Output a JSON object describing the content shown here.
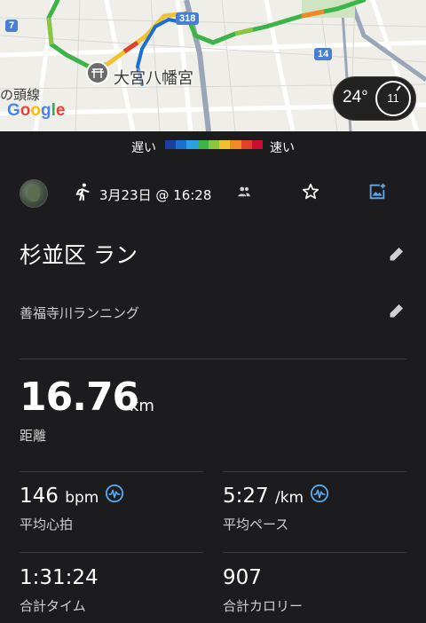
{
  "map": {
    "place_label": "大宮八幡宮",
    "left_label": "の頭線",
    "route_318": "318",
    "route_14": "14",
    "route_7": "7",
    "google_letters": [
      "G",
      "o",
      "o",
      "g",
      "l",
      "e"
    ],
    "google_colors": [
      "#4285F4",
      "#EA4335",
      "#FBBC05",
      "#4285F4",
      "#34A853",
      "#EA4335"
    ],
    "temperature": "24°",
    "wind": "11"
  },
  "legend": {
    "slow": "遅い",
    "fast": "速い",
    "colors": [
      "#1e3fa0",
      "#1a6fd0",
      "#2aa0e0",
      "#3cb44a",
      "#8cc63f",
      "#f2c12e",
      "#f08a24",
      "#e2402a",
      "#c8102e"
    ]
  },
  "header": {
    "date": "3月23日 @ 16:28"
  },
  "activity": {
    "title": "杉並区 ラン",
    "description": "善福寺川ランニング"
  },
  "distance": {
    "value": "16.76",
    "unit": "km",
    "label": "距離"
  },
  "stats": {
    "heart_rate_value": "146",
    "heart_rate_unit": "bpm",
    "heart_rate_label": "平均心拍",
    "pace_value": "5:27",
    "pace_unit": "/km",
    "pace_label": "平均ペース",
    "time_value": "1:31:24",
    "time_label": "合計タイム",
    "calories_value": "907",
    "calories_label": "合計カロリー"
  },
  "colors": {
    "background": "#1c1c1e",
    "accent_blue": "#5aa9ef",
    "divider": "#3a3a3c"
  }
}
